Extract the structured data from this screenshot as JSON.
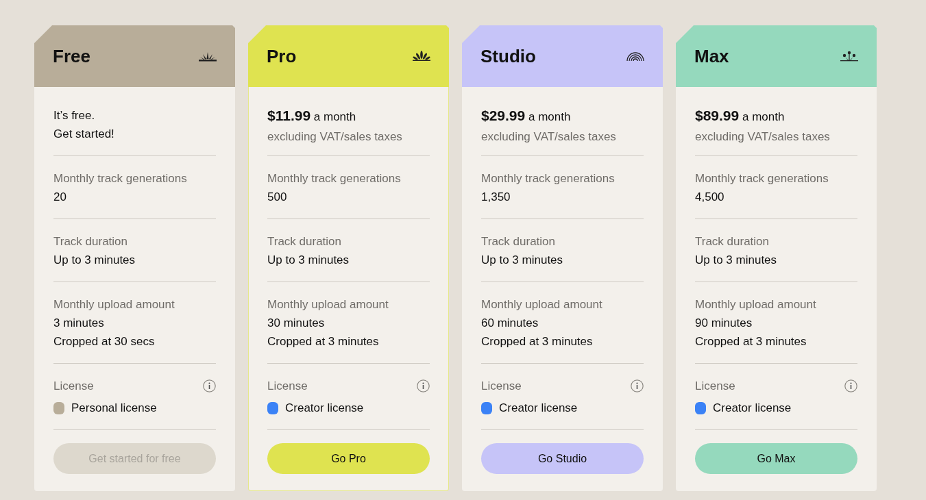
{
  "plans": [
    {
      "name": "Free",
      "color": "#b8ad99",
      "kind": "sunrise",
      "selected": false,
      "price_lines": [
        {
          "kind": "plain",
          "text": "It’s free."
        },
        {
          "kind": "plain",
          "text": "Get started!"
        }
      ],
      "features": [
        {
          "label": "Monthly track generations",
          "values": [
            "20"
          ]
        },
        {
          "label": "Track duration",
          "values": [
            "Up to 3 minutes"
          ]
        },
        {
          "label": "Monthly upload amount",
          "values": [
            "3 minutes",
            "Cropped at 30 secs"
          ]
        }
      ],
      "license": {
        "label": "License",
        "name": "Personal license",
        "color": "#b8ad99"
      },
      "button": {
        "label": "Get started for free",
        "disabled": true
      }
    },
    {
      "name": "Pro",
      "color": "#dfe350",
      "kind": "burst",
      "selected": true,
      "price_lines": [
        {
          "kind": "price",
          "text": "**$11.99** a month"
        },
        {
          "kind": "note",
          "text": "excluding VAT/sales taxes"
        }
      ],
      "features": [
        {
          "label": "Monthly track generations",
          "values": [
            "500"
          ]
        },
        {
          "label": "Track duration",
          "values": [
            "Up to 3 minutes"
          ]
        },
        {
          "label": "Monthly upload amount",
          "values": [
            "30 minutes",
            "Cropped at 3 minutes"
          ]
        }
      ],
      "license": {
        "label": "License",
        "name": "Creator license",
        "color": "#3b82f6"
      },
      "button": {
        "label": "Go Pro",
        "disabled": false
      }
    },
    {
      "name": "Studio",
      "color": "#c6c4f8",
      "kind": "rainbow",
      "selected": false,
      "price_lines": [
        {
          "kind": "price",
          "text": "**$29.99** a month"
        },
        {
          "kind": "note",
          "text": "excluding VAT/sales taxes"
        }
      ],
      "features": [
        {
          "label": "Monthly track generations",
          "values": [
            "1,350"
          ]
        },
        {
          "label": "Track duration",
          "values": [
            "Up to 3 minutes"
          ]
        },
        {
          "label": "Monthly upload amount",
          "values": [
            "60 minutes",
            "Cropped at 3 minutes"
          ]
        }
      ],
      "license": {
        "label": "License",
        "name": "Creator license",
        "color": "#3b82f6"
      },
      "button": {
        "label": "Go Studio",
        "disabled": false
      }
    },
    {
      "name": "Max",
      "color": "#95d9bd",
      "kind": "sprout",
      "selected": false,
      "price_lines": [
        {
          "kind": "price",
          "text": "**$89.99** a month"
        },
        {
          "kind": "note",
          "text": "excluding VAT/sales taxes"
        }
      ],
      "features": [
        {
          "label": "Monthly track generations",
          "values": [
            "4,500"
          ]
        },
        {
          "label": "Track duration",
          "values": [
            "Up to 3 minutes"
          ]
        },
        {
          "label": "Monthly upload amount",
          "values": [
            "90 minutes",
            "Cropped at 3 minutes"
          ]
        }
      ],
      "license": {
        "label": "License",
        "name": "Creator license",
        "color": "#3b82f6"
      },
      "button": {
        "label": "Go Max",
        "disabled": false
      }
    }
  ]
}
